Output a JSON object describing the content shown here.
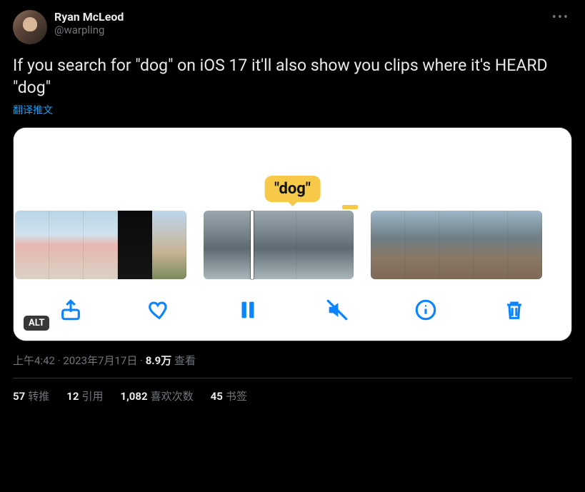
{
  "author": {
    "display_name": "Ryan McLeod",
    "handle": "@warpling"
  },
  "more_glyph": "•••",
  "body_text": "If you search for \"dog\" on iOS 17 it'll also show you clips where it's HEARD \"dog\"",
  "translate_label": "翻译推文",
  "media": {
    "chip_label": "\"dog\"",
    "alt_badge": "ALT"
  },
  "meta": {
    "time": "上午4:42",
    "sep": " · ",
    "date": "2023年7月17日",
    "views_count": "8.9万",
    "views_label": " 查看"
  },
  "stats": {
    "retweets": {
      "count": "57",
      "label": "转推"
    },
    "quotes": {
      "count": "12",
      "label": "引用"
    },
    "likes": {
      "count": "1,082",
      "label": "喜欢次数"
    },
    "bookmarks": {
      "count": "45",
      "label": "书签"
    }
  }
}
